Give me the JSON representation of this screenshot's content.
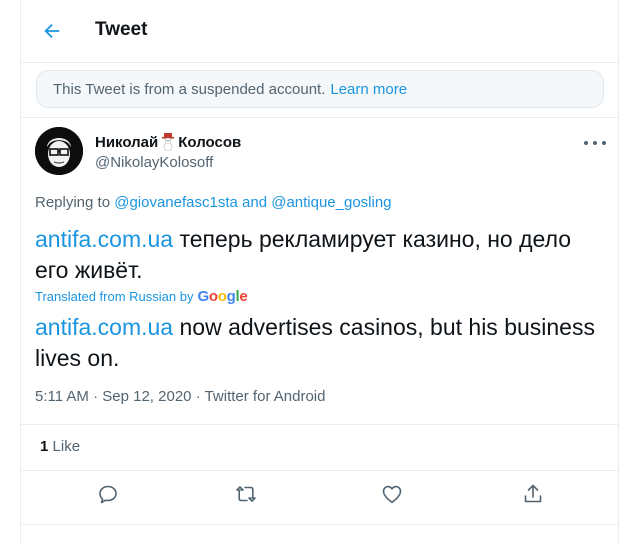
{
  "header": {
    "title": "Tweet",
    "back_icon": "arrow-left-icon"
  },
  "notice": {
    "text": "This Tweet is from a suspended account.",
    "link": "Learn more"
  },
  "author": {
    "name_part1": "Николай",
    "name_emoji": "snowman-icon",
    "name_part2": "Колосов",
    "handle": "@NikolayKolosoff"
  },
  "replying": {
    "prefix": "Replying to",
    "users": "@giovanefasc1sta and @antique_gosling"
  },
  "tweet": {
    "original_link": "antifa.com.ua",
    "original_rest": " теперь рекламирует казино, но дело его живёт.",
    "translated_by": "Translated from Russian by",
    "translated_link": "antifa.com.ua",
    "translated_rest": " now advertises casinos, but his business lives on."
  },
  "meta": {
    "time": "5:11 AM",
    "date": "Sep 12, 2020",
    "separator": "·",
    "source": "Twitter for Android"
  },
  "stats": {
    "likes_count": "1",
    "likes_label": "Like"
  },
  "colors": {
    "accent": "#1b95e0",
    "text": "#0f1419",
    "muted": "#536471",
    "border": "#ebeef0"
  }
}
